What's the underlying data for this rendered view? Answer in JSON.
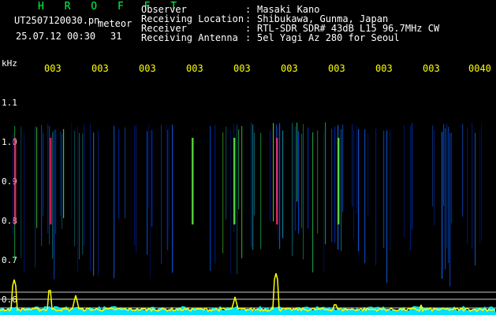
{
  "header": {
    "brand": "H R O F F T",
    "filename": "UT2507120030.pn",
    "detector_label": "meteor",
    "datetime": "25.07.12 00:30",
    "count": "31"
  },
  "info": [
    {
      "label": "Observer",
      "sep": ":",
      "value": "Masaki Kano"
    },
    {
      "label": "Receiving Location",
      "sep": ":",
      "value": "Shibukawa, Gunma, Japan"
    },
    {
      "label": "Receiver",
      "sep": ":",
      "value": "RTL-SDR SDR# 43dB L15 96.7MHz CW"
    },
    {
      "label": "Receiving Antenna",
      "sep": ":",
      "value": "5el Yagi Az 280 for Seoul"
    }
  ],
  "axis": {
    "unit": "kHz",
    "time_ticks": [
      "003",
      "003",
      "003",
      "003",
      "003",
      "003",
      "003",
      "003",
      "003",
      "0040"
    ],
    "freq_ticks": [
      "1.1",
      "1.0",
      "0.9",
      "0.8",
      "0.7",
      "0.6"
    ]
  },
  "colors": {
    "brand": "#00ff44",
    "ticks": "#ffff00",
    "background": "#000000",
    "spectrogram_low": "#000a50",
    "spectrogram_high": "#ff2266",
    "level_trace": "#ffff00",
    "noise_floor": "#00ffff"
  }
}
